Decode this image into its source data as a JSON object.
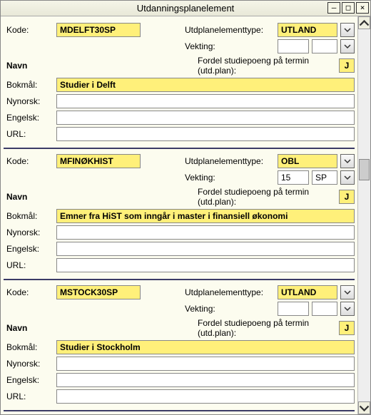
{
  "window": {
    "title": "Utdanningsplanelement"
  },
  "labels": {
    "kode": "Kode:",
    "utdplanelementtype": "Utdplanelementtype:",
    "vekting": "Vekting:",
    "fordel": "Fordel studiepoeng på termin (utd.plan):",
    "navn": "Navn",
    "bokmal": "Bokmål:",
    "nynorsk": "Nynorsk:",
    "engelsk": "Engelsk:",
    "url": "URL:",
    "jbtn": "J"
  },
  "records": [
    {
      "kode": "MDELFT30SP",
      "type": "UTLAND",
      "vekt_num": "",
      "vekt_unit": "",
      "bokmal": "Studier i Delft",
      "nynorsk": "",
      "engelsk": "",
      "url": ""
    },
    {
      "kode": "MFINØKHIST",
      "type": "OBL",
      "vekt_num": "15",
      "vekt_unit": "SP",
      "bokmal": "Emner fra HiST som inngår i master i finansiell økonomi",
      "nynorsk": "",
      "engelsk": "",
      "url": ""
    },
    {
      "kode": "MSTOCK30SP",
      "type": "UTLAND",
      "vekt_num": "",
      "vekt_unit": "",
      "bokmal": "Studier i Stockholm",
      "nynorsk": "",
      "engelsk": "",
      "url": ""
    }
  ]
}
